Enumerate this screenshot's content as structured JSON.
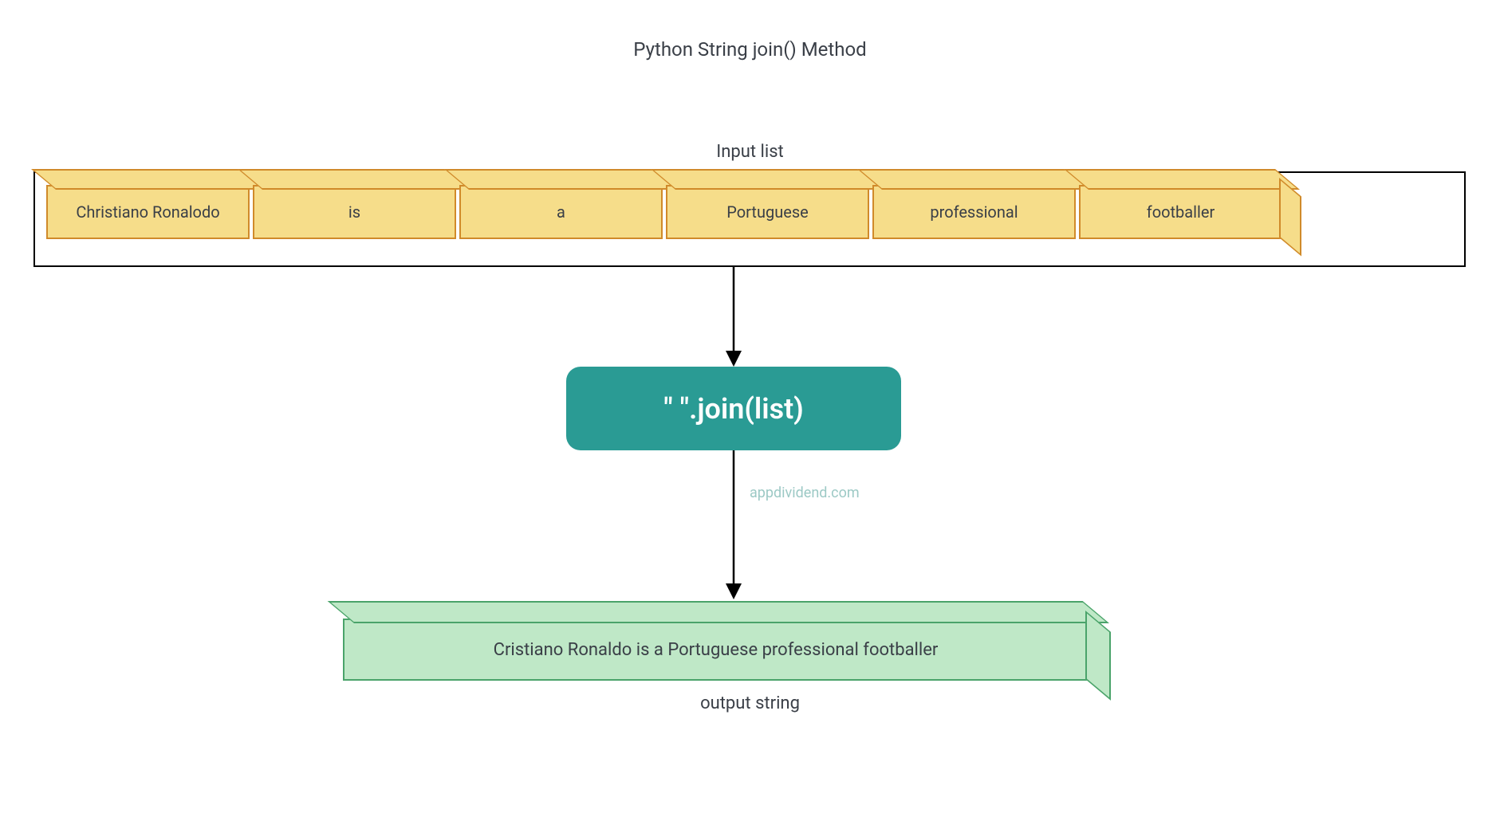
{
  "title": "Python String join() Method",
  "input_label": "Input list",
  "blocks": [
    "Christiano Ronalodo",
    "is",
    "a",
    "Portuguese",
    "professional",
    "footballer"
  ],
  "join_expression": "\" \".join(list)",
  "watermark": "appdividend.com",
  "output_string": "Cristiano Ronaldo is a Portuguese professional footballer",
  "output_label": "output string",
  "block_widths": [
    255,
    255,
    255,
    255,
    255,
    255
  ],
  "colors": {
    "block_fill": "#f6dd8a",
    "block_border": "#d08a2a",
    "join_fill": "#2a9b94",
    "output_fill": "#bfe8c7",
    "output_border": "#4aa36a"
  }
}
